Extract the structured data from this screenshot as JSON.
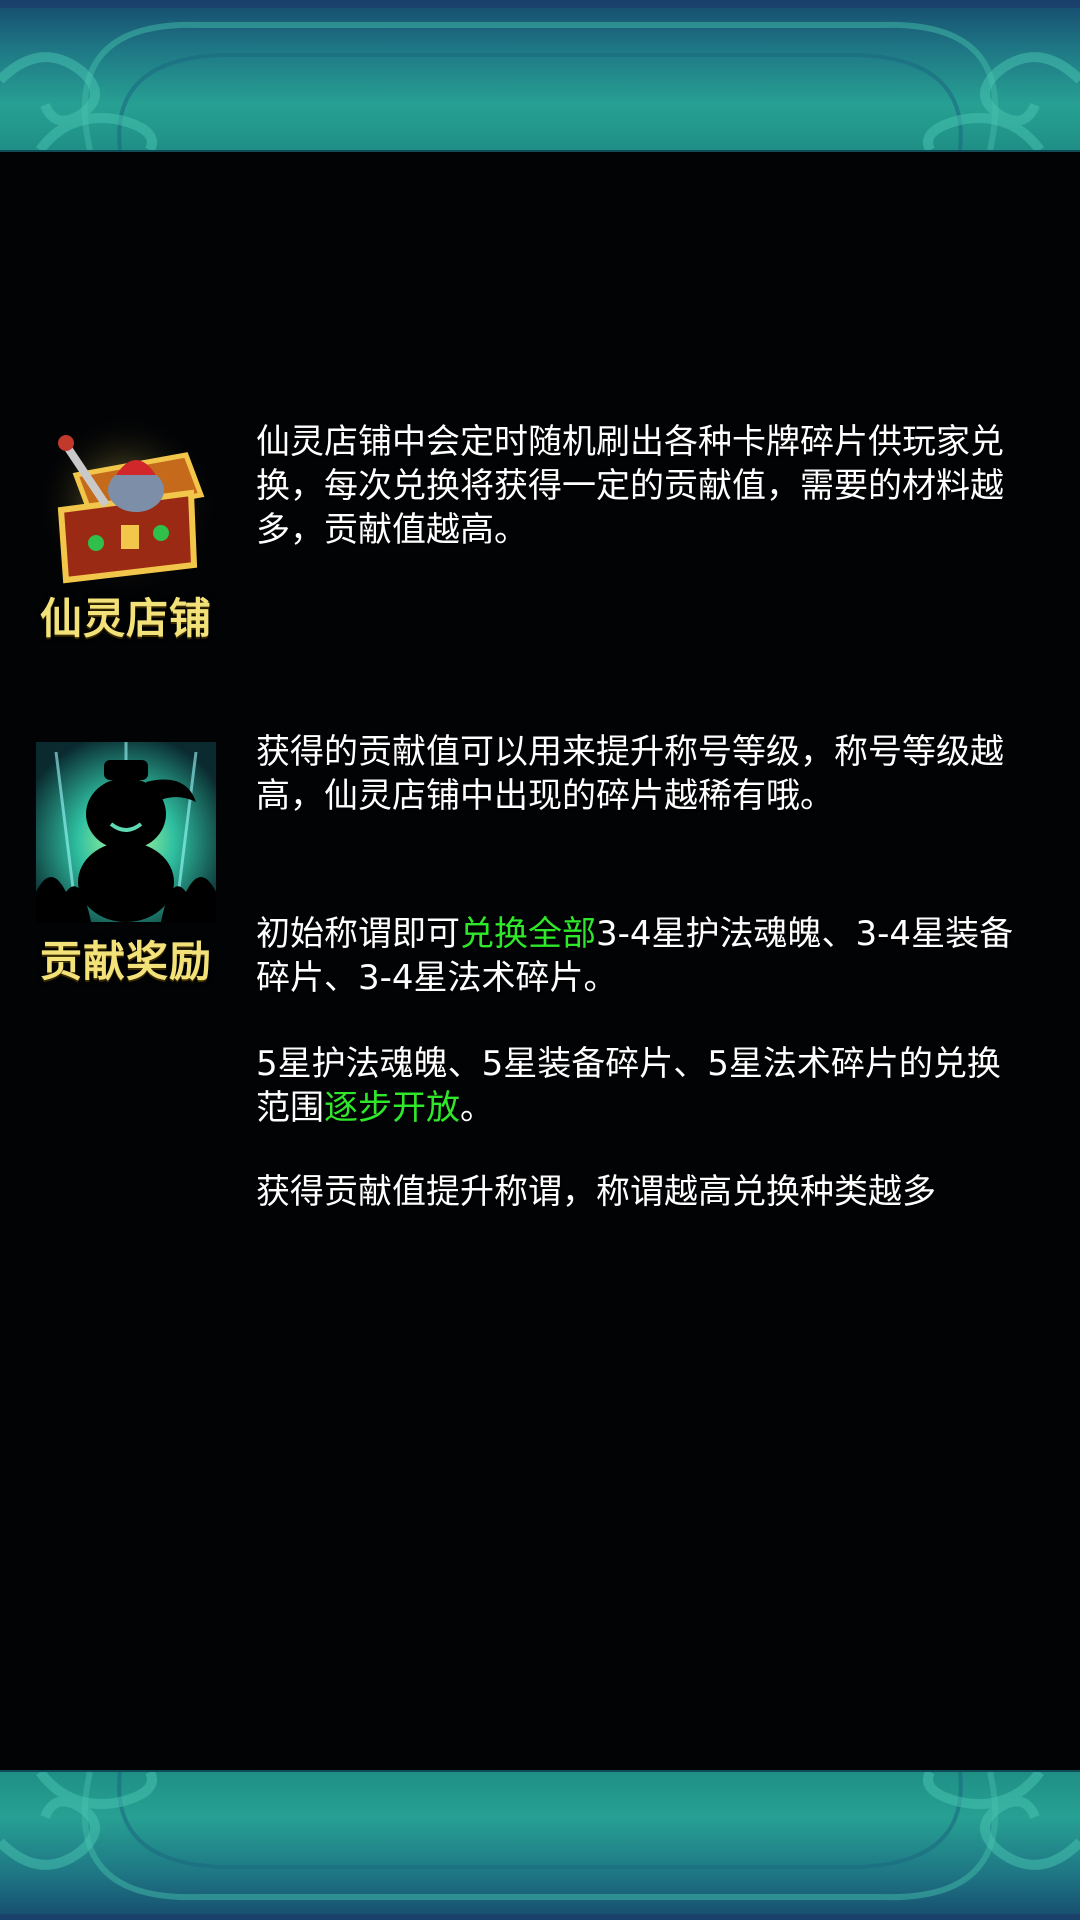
{
  "shop": {
    "title": "仙灵店铺",
    "icon": "treasure-chest-icon",
    "description": "仙灵店铺中会定时随机刷出各种卡牌碎片供玩家兑换，每次兑换将获得一定的贡献值，需要的材料越多，贡献值越高。"
  },
  "reward": {
    "title": "贡献奖励",
    "icon": "silhouette-character-icon",
    "description": "获得的贡献值可以用来提升称号等级，称号等级越高，仙灵店铺中出现的碎片越稀有哦。",
    "initial": {
      "prefix": "初始称谓即可",
      "highlight": "兑换全部",
      "suffix": "3-4星护法魂魄、3-4星装备碎片、3-4星法术碎片。"
    },
    "five_star": {
      "prefix": "5星护法魂魄、5星装备碎片、5星法术碎片的兑换范围",
      "highlight": "逐步开放",
      "suffix": "。"
    },
    "footer": "获得贡献值提升称谓，称谓越高兑换种类越多"
  },
  "colors": {
    "title_yellow": "#f3e27a",
    "highlight_green": "#2fe82a",
    "banner_teal": "#27a093",
    "background": "#020305"
  }
}
